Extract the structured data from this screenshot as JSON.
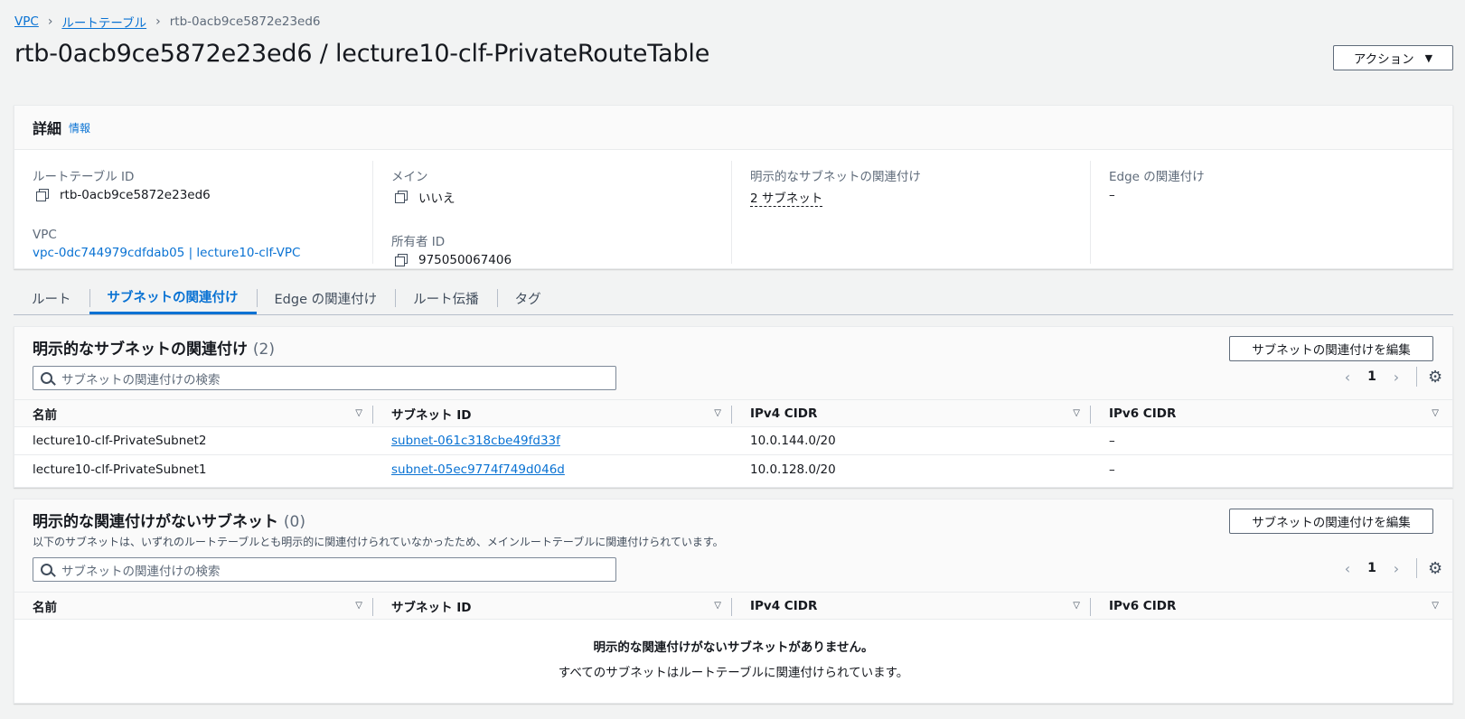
{
  "breadcrumb": {
    "root": "VPC",
    "parent": "ルートテーブル",
    "current": "rtb-0acb9ce5872e23ed6"
  },
  "title": "rtb-0acb9ce5872e23ed6 / lecture10-clf-PrivateRouteTable",
  "actions_label": "アクション",
  "details": {
    "heading": "詳細",
    "info": "情報",
    "route_table_id_label": "ルートテーブル ID",
    "route_table_id": "rtb-0acb9ce5872e23ed6",
    "vpc_label": "VPC",
    "vpc_value": "vpc-0dc744979cdfdab05 | lecture10-clf-VPC",
    "main_label": "メイン",
    "main_value": "いいえ",
    "owner_label": "所有者 ID",
    "owner_value": "975050067406",
    "explicit_label": "明示的なサブネットの関連付け",
    "explicit_value": "2 サブネット",
    "edge_label": "Edge の関連付け",
    "edge_value": "–"
  },
  "tabs": [
    "ルート",
    "サブネットの関連付け",
    "Edge の関連付け",
    "ルート伝播",
    "タグ"
  ],
  "columns": [
    "名前",
    "サブネット ID",
    "IPv4 CIDR",
    "IPv6 CIDR"
  ],
  "explicit": {
    "title": "明示的なサブネットの関連付け",
    "count": "(2)",
    "edit_label": "サブネットの関連付けを編集",
    "search_placeholder": "サブネットの関連付けの検索",
    "page": "1",
    "rows": [
      {
        "name": "lecture10-clf-PrivateSubnet2",
        "subnet_id": "subnet-061c318cbe49fd33f",
        "ipv4": "10.0.144.0/20",
        "ipv6": "–"
      },
      {
        "name": "lecture10-clf-PrivateSubnet1",
        "subnet_id": "subnet-05ec9774f749d046d",
        "ipv4": "10.0.128.0/20",
        "ipv6": "–"
      }
    ]
  },
  "unassociated": {
    "title": "明示的な関連付けがないサブネット",
    "count": "(0)",
    "description": "以下のサブネットは、いずれのルートテーブルとも明示的に関連付けられていなかったため、メインルートテーブルに関連付けられています。",
    "edit_label": "サブネットの関連付けを編集",
    "search_placeholder": "サブネットの関連付けの検索",
    "page": "1",
    "empty_title": "明示的な関連付けがないサブネットがありません。",
    "empty_desc": "すべてのサブネットはルートテーブルに関連付けられています。"
  }
}
